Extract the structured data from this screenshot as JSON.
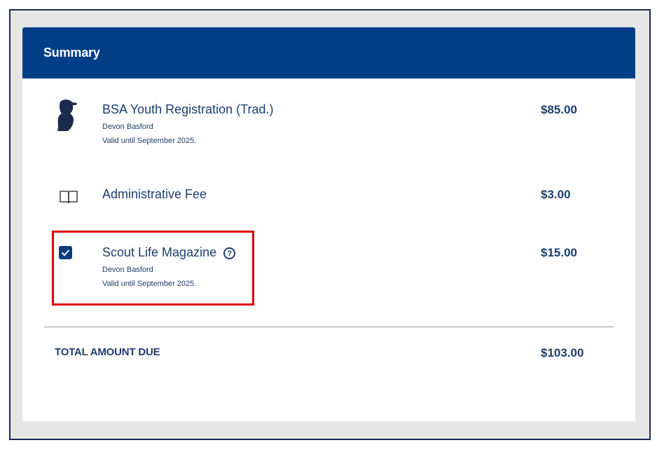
{
  "summary": {
    "title": "Summary",
    "items": [
      {
        "name": "BSA Youth Registration (Trad.)",
        "member": "Devon Basford",
        "valid": "Valid until September 2025.",
        "price": "$85.00",
        "icon": "scout-silhouette-icon"
      },
      {
        "name": "Administrative Fee",
        "price": "$3.00",
        "icon": "book-icon"
      },
      {
        "name": "Scout Life Magazine",
        "member": "Devon Basford",
        "valid": "Valid until September 2025.",
        "price": "$15.00",
        "icon": "checkbox-checked-icon",
        "checked": true,
        "help_glyph": "?"
      }
    ],
    "total_label": "TOTAL AMOUNT DUE",
    "total_value": "$103.00"
  },
  "colors": {
    "header_bg": "#003f87",
    "text": "#1c3e6e",
    "highlight": "#e00000",
    "frame_bg": "#e6e6e6"
  }
}
